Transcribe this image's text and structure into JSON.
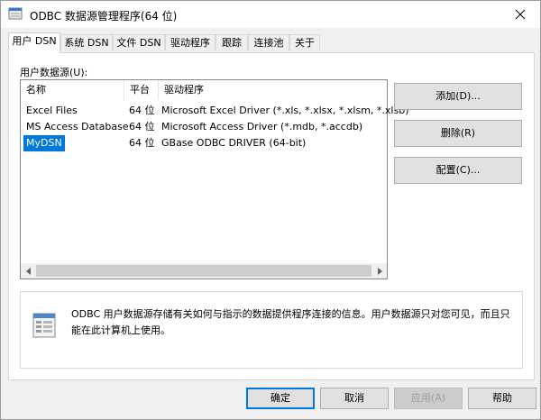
{
  "window": {
    "title": "ODBC 数据源管理程序(64 位)",
    "close_icon": "close-icon",
    "app_icon": "odbc-icon"
  },
  "tabs": [
    {
      "label": "用户 DSN",
      "active": true
    },
    {
      "label": "系统 DSN",
      "active": false
    },
    {
      "label": "文件 DSN",
      "active": false
    },
    {
      "label": "驱动程序",
      "active": false
    },
    {
      "label": "跟踪",
      "active": false
    },
    {
      "label": "连接池",
      "active": false
    },
    {
      "label": "关于",
      "active": false
    }
  ],
  "panel": {
    "section_label": "用户数据源(U):",
    "columns": [
      "名称",
      "平台",
      "驱动程序"
    ],
    "rows": [
      {
        "name": "Excel Files",
        "platform": "64 位",
        "driver": "Microsoft Excel Driver (*.xls, *.xlsx, *.xlsm, *.xlsb)",
        "selected": false
      },
      {
        "name": "MS Access Database",
        "platform": "64 位",
        "driver": "Microsoft Access Driver (*.mdb, *.accdb)",
        "selected": false
      },
      {
        "name": "MyDSN",
        "platform": "64 位",
        "driver": "GBase ODBC DRIVER (64-bit)",
        "selected": true
      }
    ],
    "buttons": {
      "add": "添加(D)...",
      "remove": "删除(R)",
      "configure": "配置(C)..."
    },
    "info_text": "ODBC 用户数据源存储有关如何与指示的数据提供程序连接的信息。用户数据源只对您可见，而且只能在此计算机上使用。",
    "info_icon": "datasource-info-icon"
  },
  "footer": {
    "ok": "确定",
    "cancel": "取消",
    "apply": "应用(A)",
    "help": "帮助"
  },
  "colors": {
    "selection": "#0078d7",
    "window_bg": "#f0f0f0",
    "button_bg": "#e1e1e1"
  }
}
